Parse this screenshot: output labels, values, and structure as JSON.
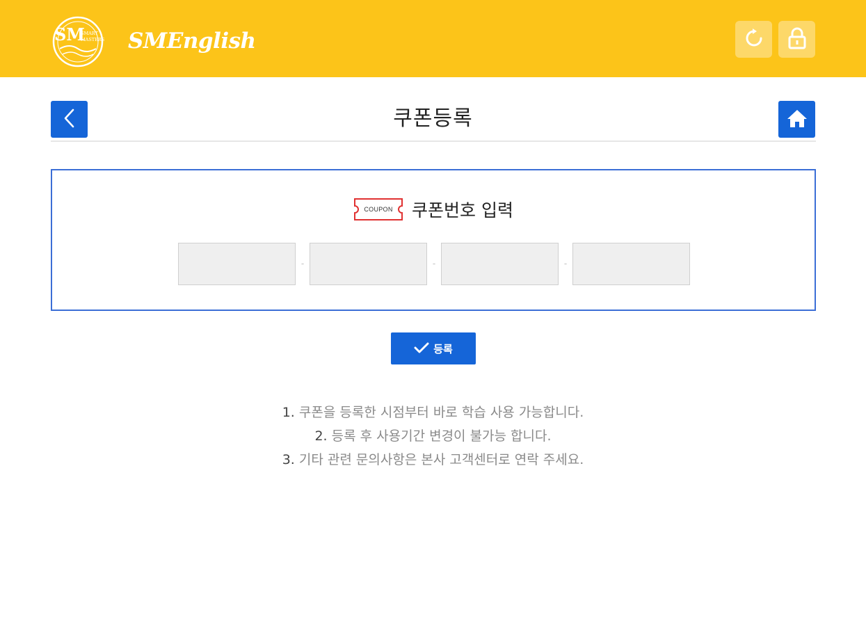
{
  "header": {
    "brand_name": "SMEnglish",
    "logo_mark_text": "SM",
    "logo_small_lines": [
      "SMART",
      "MASTERS"
    ],
    "refresh_icon": "refresh-icon",
    "lock_icon": "lock-icon",
    "colors": {
      "background": "#fcc419",
      "button_overlay": "rgba(255,255,255,0.35)"
    }
  },
  "title_bar": {
    "title": "쿠폰등록",
    "back_icon": "chevron-left-icon",
    "home_icon": "home-icon",
    "accent": "#1565d8"
  },
  "coupon": {
    "ticket_label": "COUPON",
    "heading": "쿠폰번호 입력",
    "fields": [
      {
        "value": "",
        "placeholder": ""
      },
      {
        "value": "",
        "placeholder": ""
      },
      {
        "value": "",
        "placeholder": ""
      },
      {
        "value": "",
        "placeholder": ""
      }
    ],
    "separator": "-",
    "border_color": "#3b6ed6"
  },
  "register_button": {
    "label": "등록",
    "icon": "check-icon"
  },
  "notes": [
    {
      "num": "1.",
      "text": " 쿠폰을 등록한 시점부터 바로 학습 사용 가능합니다."
    },
    {
      "num": "2.",
      "text": " 등록 후 사용기간 변경이 불가능 합니다."
    },
    {
      "num": "3.",
      "text": " 기타 관련 문의사항은 본사 고객센터로 연락 주세요."
    }
  ]
}
